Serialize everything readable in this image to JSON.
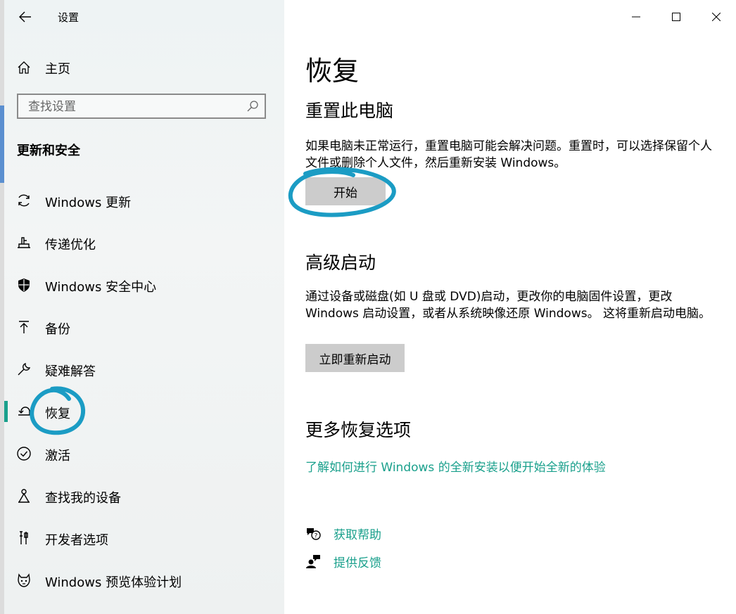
{
  "window": {
    "app_title": "设置",
    "controls": [
      "minimize-icon",
      "maximize-icon",
      "close-icon"
    ]
  },
  "sidebar": {
    "home_label": "主页",
    "search": {
      "placeholder": "查找设置",
      "value": ""
    },
    "section_title": "更新和安全",
    "items": [
      {
        "label": "Windows 更新",
        "icon": "refresh-icon"
      },
      {
        "label": "传递优化",
        "icon": "delivery-icon"
      },
      {
        "label": "Windows 安全中心",
        "icon": "shield-icon"
      },
      {
        "label": "备份",
        "icon": "backup-arrow-icon"
      },
      {
        "label": "疑难解答",
        "icon": "wrench-icon"
      },
      {
        "label": "恢复",
        "icon": "recovery-icon",
        "active": true
      },
      {
        "label": "激活",
        "icon": "check-circle-icon"
      },
      {
        "label": "查找我的设备",
        "icon": "find-device-icon"
      },
      {
        "label": "开发者选项",
        "icon": "dev-tools-icon"
      },
      {
        "label": "Windows 预览体验计划",
        "icon": "insider-cat-icon"
      }
    ]
  },
  "main": {
    "title": "恢复",
    "reset": {
      "heading": "重置此电脑",
      "description": "如果电脑未正常运行，重置电脑可能会解决问题。重置时，可以选择保留个人文件或删除个人文件，然后重新安装 Windows。",
      "button": "开始"
    },
    "advanced": {
      "heading": "高级启动",
      "description": "通过设备或磁盘(如 U 盘或 DVD)启动，更改你的电脑固件设置，更改 Windows 启动设置，或者从系统映像还原 Windows。 这将重新启动电脑。",
      "button": "立即重新启动"
    },
    "more": {
      "heading": "更多恢复选项",
      "link": "了解如何进行 Windows 的全新安装以便开始全新的体验"
    },
    "help": {
      "get_help": "获取帮助",
      "feedback": "提供反馈"
    }
  },
  "colors": {
    "accent": "#1aa08c",
    "annotation": "#1b9cc4",
    "button": "#cccccc"
  }
}
